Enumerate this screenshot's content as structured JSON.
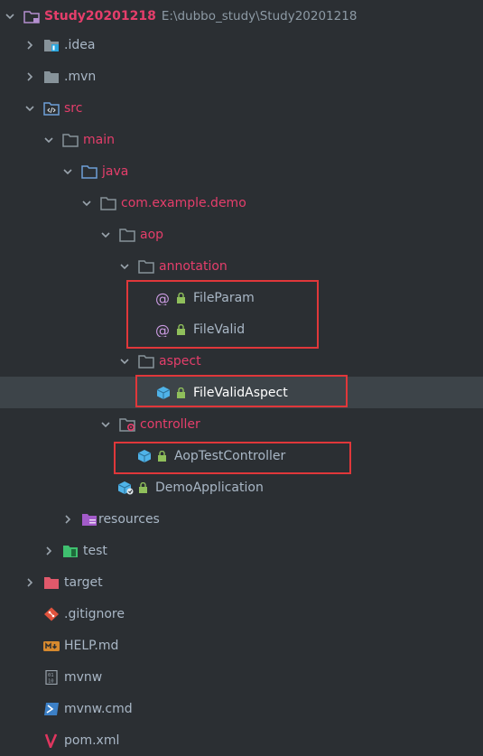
{
  "project": {
    "name": "Study20201218",
    "path": "E:\\dubbo_study\\Study20201218"
  },
  "tree": {
    "idea": ".idea",
    "mvn": ".mvn",
    "src": "src",
    "main": "main",
    "java": "java",
    "package": "com.example.demo",
    "aop": "aop",
    "annotation": "annotation",
    "file_param": "FileParam",
    "file_valid": "FileValid",
    "aspect": "aspect",
    "file_valid_aspect": "FileValidAspect",
    "controller": "controller",
    "aop_test_controller": "AopTestController",
    "demo_application": "DemoApplication",
    "resources": "resources",
    "test": "test",
    "target": "target",
    "gitignore": ".gitignore",
    "help_md": "HELP.md",
    "mvnw": "mvnw",
    "mvnw_cmd": "mvnw.cmd",
    "pom_xml": "pom.xml"
  },
  "selected_item": "FileValidAspect",
  "colors": {
    "background": "#2b2f33",
    "selection": "#3d4449",
    "text": "#a9b7c6",
    "excluded_or_source": "#e53e6b",
    "highlight_box": "#e0373a",
    "folder": "#87939a",
    "folder_blue": "#6e9fd8"
  }
}
